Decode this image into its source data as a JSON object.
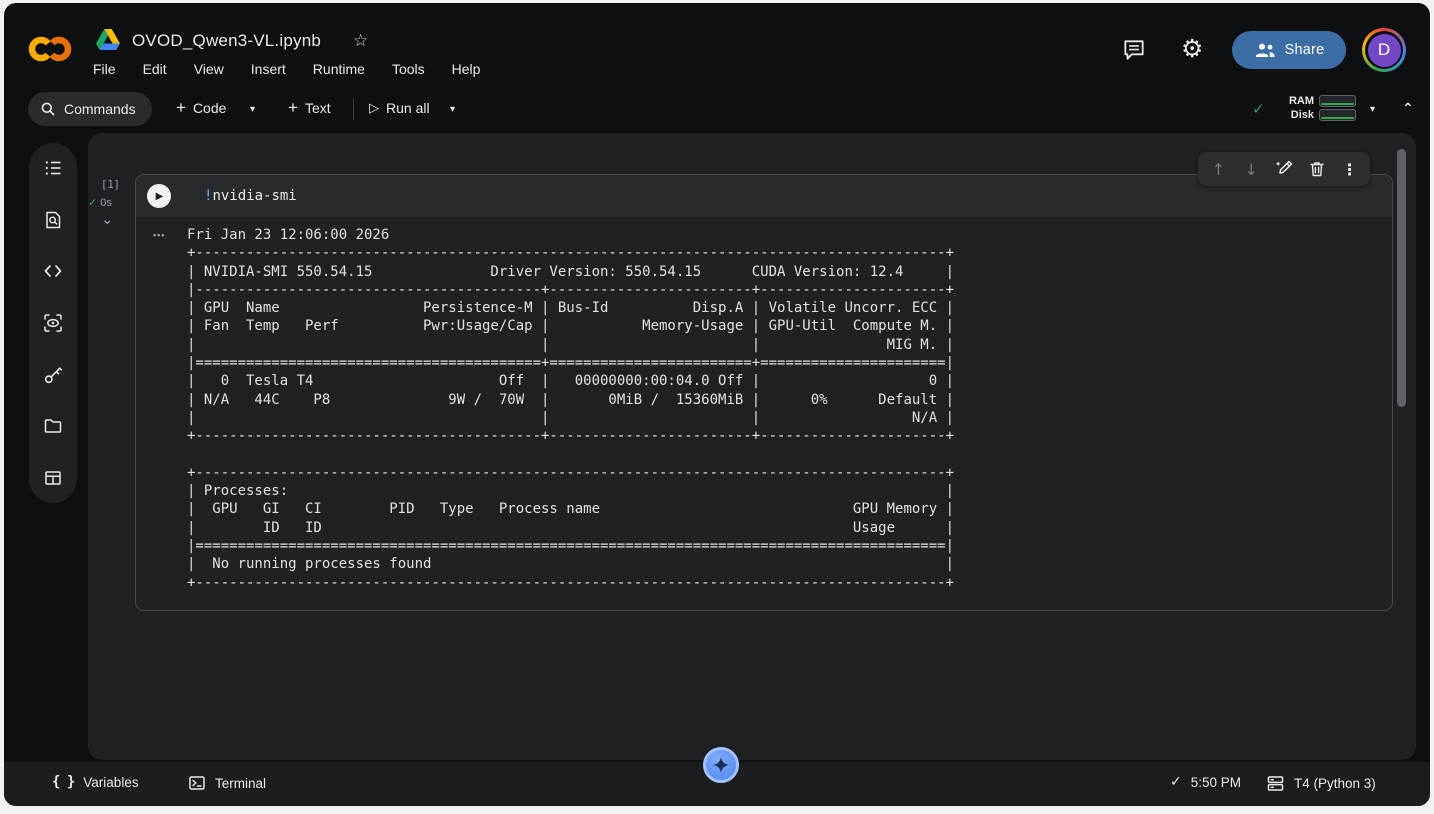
{
  "header": {
    "title": "OVOD_Qwen3-VL.ipynb",
    "menus": [
      "File",
      "Edit",
      "View",
      "Insert",
      "Runtime",
      "Tools",
      "Help"
    ],
    "share_label": "Share",
    "avatar_letter": "D"
  },
  "toolbar": {
    "commands_label": "Commands",
    "code_label": "Code",
    "text_label": "Text",
    "run_all_label": "Run all",
    "ram_label": "RAM",
    "disk_label": "Disk"
  },
  "sidebar": {
    "items": [
      {
        "name": "table-of-contents"
      },
      {
        "name": "find-and-replace"
      },
      {
        "name": "code-snippets"
      },
      {
        "name": "eye-scan"
      },
      {
        "name": "secrets"
      },
      {
        "name": "files"
      },
      {
        "name": "data-table"
      }
    ]
  },
  "cell": {
    "execution_count": "[1]",
    "status_time": "0s",
    "code_bang": "!",
    "code_rest": "nvidia-smi",
    "output": [
      "Fri Jan 23 12:06:00 2026",
      "+-----------------------------------------------------------------------------------------+",
      "| NVIDIA-SMI 550.54.15              Driver Version: 550.54.15      CUDA Version: 12.4     |",
      "|-----------------------------------------+------------------------+----------------------+",
      "| GPU  Name                 Persistence-M | Bus-Id          Disp.A | Volatile Uncorr. ECC |",
      "| Fan  Temp   Perf          Pwr:Usage/Cap |           Memory-Usage | GPU-Util  Compute M. |",
      "|                                         |                        |               MIG M. |",
      "|=========================================+========================+======================|",
      "|   0  Tesla T4                      Off  |   00000000:00:04.0 Off |                    0 |",
      "| N/A   44C    P8              9W /  70W  |       0MiB /  15360MiB |      0%      Default |",
      "|                                         |                        |                  N/A |",
      "+-----------------------------------------+------------------------+----------------------+",
      "",
      "+-----------------------------------------------------------------------------------------+",
      "| Processes:                                                                              |",
      "|  GPU   GI   CI        PID   Type   Process name                              GPU Memory |",
      "|        ID   ID                                                               Usage      |",
      "|=========================================================================================|",
      "|  No running processes found                                                             |",
      "+-----------------------------------------------------------------------------------------+"
    ]
  },
  "statusbar": {
    "variables_label": "Variables",
    "terminal_label": "Terminal",
    "time": "5:50 PM",
    "runtime_label": "T4 (Python 3)"
  },
  "icons": {
    "star": "☆",
    "caret_down": "▾",
    "run_glyph": "▷",
    "play_glyph": "▶",
    "check": "✓",
    "chevron_down": "⌄",
    "chevron_up": "⌃",
    "arrow_up": "↑",
    "arrow_down": "↓",
    "kebab": "⋮",
    "output_menu_dots": "•••",
    "plus": "+",
    "braces": "{ }",
    "gear": "⚙"
  },
  "colors": {
    "accent_blue": "#7baaf8",
    "share_blue": "#3c6ea5",
    "status_green": "#34a853",
    "panel_bg": "#202124",
    "window_bg": "#0e0f10"
  }
}
